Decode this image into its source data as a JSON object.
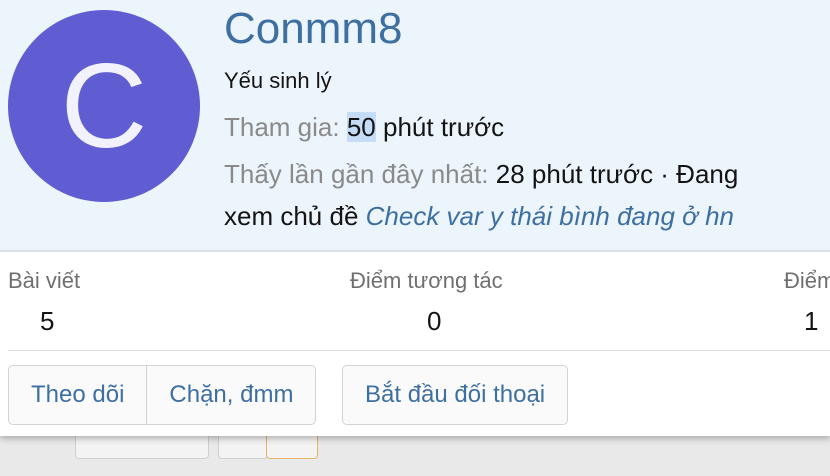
{
  "profile": {
    "avatar_letter": "C",
    "username": "Conmm8",
    "user_title": "Yếu sinh lý",
    "joined_label": "Tham gia:",
    "joined_value_highlight": "50",
    "joined_value_rest": " phút trước",
    "last_seen_label": "Thấy lần gần đây nhất:",
    "last_seen_value": "28 phút trước · Đang",
    "activity_prefix": "xem chủ đề ",
    "activity_thread": "Check var y thái bình đang ở hn",
    "avatar_color": "#5f5dd1",
    "link_color": "#3e6fa1"
  },
  "stats": [
    {
      "label": "Bài viết",
      "value": "5"
    },
    {
      "label": "Điểm tương tác",
      "value": "0"
    },
    {
      "label": "Điểm",
      "value": "1"
    }
  ],
  "actions": {
    "follow": "Theo dõi",
    "block": "Chặn, đmm",
    "start_conversation": "Bắt đầu đối thoại"
  }
}
